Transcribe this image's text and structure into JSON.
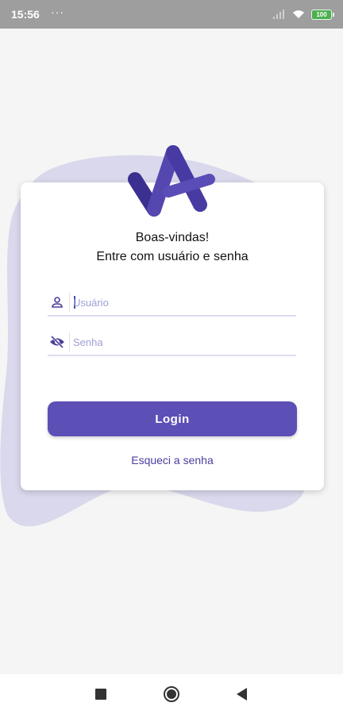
{
  "status_bar": {
    "time": "15:56",
    "dots": "···",
    "battery": "100"
  },
  "card": {
    "greeting_line1": "Boas-vindas!",
    "greeting_line2": "Entre com usuário e senha",
    "username": {
      "placeholder": "Usuário",
      "icon": "user-icon"
    },
    "password": {
      "placeholder": "Senha",
      "icon": "eye-off-icon"
    },
    "login_label": "Login",
    "forgot_label": "Esqueci a senha"
  },
  "colors": {
    "brand": "#5c4fb6",
    "blob": "#d9d8ec",
    "link": "#4a3f9c"
  },
  "nav_bar": {
    "icons": [
      "square-icon",
      "home-circle-icon",
      "back-triangle-icon"
    ]
  }
}
